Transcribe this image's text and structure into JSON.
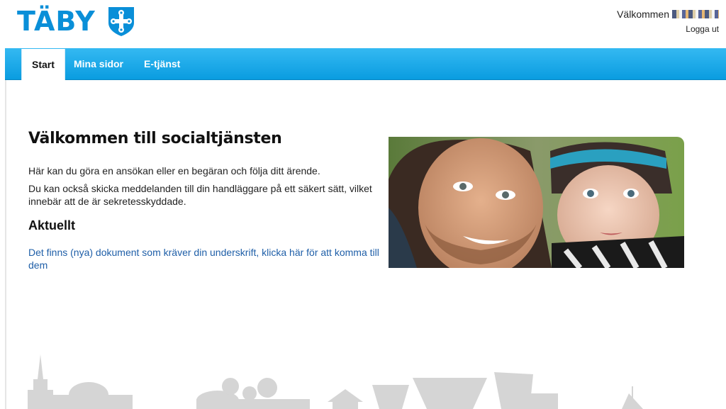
{
  "header": {
    "logo_text": "TÄBY",
    "welcome_label": "Välkommen",
    "logout_label": "Logga ut"
  },
  "nav": {
    "tabs": [
      {
        "label": "Start",
        "active": true
      },
      {
        "label": "Mina sidor",
        "active": false
      },
      {
        "label": "E-tjänst",
        "active": false
      }
    ]
  },
  "main": {
    "title": "Välkommen till socialtjänsten",
    "paragraphs": [
      "Här kan du göra en ansökan eller en begäran och följa ditt ärende.",
      "Du kan också skicka meddelanden till din handläggare på ett säkert sätt, vilket innebär att de är sekretesskyddade."
    ],
    "news_heading": "Aktuellt",
    "news_link": "Det finns (nya) dokument som kräver din underskrift, klicka här för att komma till dem"
  },
  "colors": {
    "brand_blue": "#0a8fd8",
    "nav_top": "#34b9f2",
    "nav_bottom": "#0a9ce0",
    "link": "#1f5fa8",
    "skyline": "#d5d5d5"
  },
  "icons": {
    "logo_shield": "shield-cross-icon"
  }
}
